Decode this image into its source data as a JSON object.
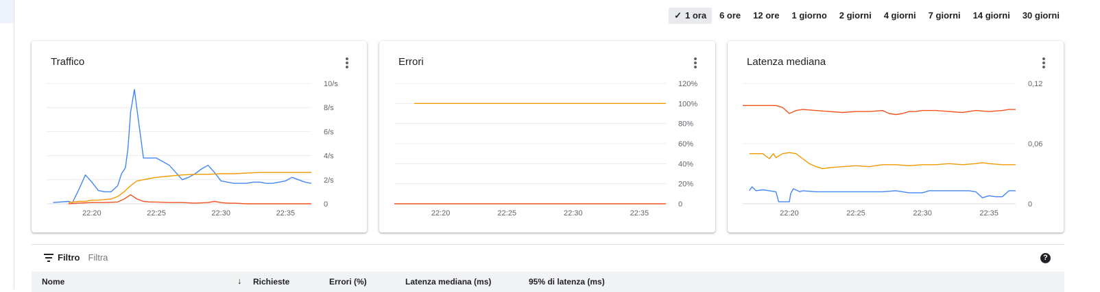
{
  "time_range": {
    "options": [
      "1 ora",
      "6 ore",
      "12 ore",
      "1 giorno",
      "2 giorni",
      "4 giorni",
      "7 giorni",
      "14 giorni",
      "30 giorni"
    ],
    "selected": "1 ora"
  },
  "filter": {
    "label": "Filtro",
    "placeholder": "Filtra"
  },
  "table": {
    "columns": [
      "Nome",
      "Richieste",
      "Errori (%)",
      "Latenza mediana (ms)",
      "95% di latenza (ms)"
    ],
    "sorted_column": "Richieste"
  },
  "colors": {
    "blue": "#4285f4",
    "orange": "#f29900",
    "red": "#f4511e"
  },
  "chart_data": [
    {
      "type": "line",
      "title": "Traffico",
      "x_ticks": [
        "22:20",
        "22:25",
        "22:30",
        "22:35"
      ],
      "y_ticks": [
        "0",
        "2/s",
        "4/s",
        "6/s",
        "8/s",
        "10/s"
      ],
      "ylim": [
        0,
        10
      ],
      "grid": true,
      "series": [
        {
          "color": "#4285f4",
          "x": [
            17,
            18.2,
            18.5,
            19,
            19.5,
            20,
            20.5,
            21,
            21.5,
            22,
            22.3,
            22.6,
            22.8,
            23,
            23.3,
            23.6,
            24,
            24.5,
            25,
            25.5,
            26,
            26.5,
            27,
            27.5,
            28,
            28.5,
            29,
            29.5,
            30,
            30.5,
            31,
            31.5,
            32,
            32.5,
            33,
            33.5,
            34,
            34.5,
            35,
            35.5,
            36,
            36.5,
            37
          ],
          "y": [
            0.1,
            0.2,
            0.1,
            1.2,
            2.4,
            1.8,
            1.1,
            1.0,
            1.0,
            1.5,
            2.5,
            3.0,
            4.6,
            7.6,
            9.5,
            7.0,
            3.8,
            3.8,
            3.8,
            3.5,
            3.2,
            2.6,
            2.0,
            2.2,
            2.5,
            2.9,
            3.2,
            2.6,
            1.9,
            1.8,
            1.7,
            1.7,
            1.7,
            1.8,
            1.8,
            1.7,
            1.7,
            1.8,
            1.9,
            2.2,
            2.0,
            1.8,
            1.7
          ]
        },
        {
          "color": "#f29900",
          "x": [
            18.2,
            19,
            19.5,
            20,
            20.5,
            21,
            21.5,
            22,
            22.5,
            23,
            23.5,
            24,
            24.5,
            25,
            26,
            27,
            28,
            29,
            30,
            31,
            32,
            33,
            34,
            35,
            36,
            37
          ],
          "y": [
            0.1,
            0.2,
            0.2,
            0.3,
            0.3,
            0.35,
            0.4,
            0.6,
            1.0,
            1.5,
            1.9,
            2.0,
            2.1,
            2.2,
            2.3,
            2.4,
            2.45,
            2.45,
            2.5,
            2.5,
            2.55,
            2.6,
            2.6,
            2.6,
            2.6,
            2.6
          ]
        },
        {
          "color": "#f4511e",
          "x": [
            18.2,
            19,
            20,
            21,
            22,
            22.5,
            23,
            23.5,
            24,
            24.5,
            25,
            26,
            27,
            28,
            29,
            29.5,
            30,
            30.5,
            31,
            32,
            33,
            34,
            35,
            36,
            37
          ],
          "y": [
            0,
            0.05,
            0.1,
            0.1,
            0.15,
            0.4,
            0.75,
            0.4,
            0.2,
            0.15,
            0.15,
            0.1,
            0.1,
            0.05,
            0.1,
            0.2,
            0.1,
            0.05,
            0.05,
            0,
            0,
            0,
            0,
            0,
            0
          ]
        }
      ]
    },
    {
      "type": "line",
      "title": "Errori",
      "x_ticks": [
        "22:20",
        "22:25",
        "22:30",
        "22:35"
      ],
      "y_ticks": [
        "0",
        "20%",
        "40%",
        "60%",
        "80%",
        "100%",
        "120%"
      ],
      "ylim": [
        0,
        120
      ],
      "grid": true,
      "series": [
        {
          "color": "#f29900",
          "x": [
            18,
            37
          ],
          "y": [
            100,
            100
          ]
        },
        {
          "color": "#f4511e",
          "x": [
            16.5,
            37
          ],
          "y": [
            0,
            0
          ]
        }
      ]
    },
    {
      "type": "line",
      "title": "Latenza mediana",
      "x_ticks": [
        "22:20",
        "22:25",
        "22:30",
        "22:35"
      ],
      "y_ticks": [
        "0",
        "0,06",
        "0,12"
      ],
      "ylim": [
        0,
        0.12
      ],
      "grid": true,
      "series": [
        {
          "color": "#f4511e",
          "x": [
            16.5,
            19,
            19.5,
            20,
            20.5,
            21,
            22,
            23,
            24,
            25,
            26,
            27,
            27.5,
            28,
            28.5,
            29,
            29.5,
            30,
            31,
            32,
            33,
            34,
            35,
            36,
            36.5,
            37
          ],
          "y": [
            0.098,
            0.098,
            0.096,
            0.09,
            0.093,
            0.094,
            0.093,
            0.092,
            0.091,
            0.092,
            0.092,
            0.093,
            0.09,
            0.089,
            0.09,
            0.092,
            0.092,
            0.093,
            0.093,
            0.092,
            0.091,
            0.093,
            0.092,
            0.093,
            0.094,
            0.094
          ]
        },
        {
          "color": "#f29900",
          "x": [
            17,
            18,
            18.5,
            18.8,
            19,
            19.5,
            20,
            20.5,
            21,
            21.5,
            22,
            22.5,
            23,
            24,
            25,
            26,
            27,
            28,
            29,
            30,
            31,
            32,
            33,
            34,
            34.5,
            35,
            36,
            37
          ],
          "y": [
            0.05,
            0.05,
            0.045,
            0.05,
            0.046,
            0.05,
            0.051,
            0.05,
            0.045,
            0.04,
            0.037,
            0.035,
            0.036,
            0.037,
            0.038,
            0.037,
            0.039,
            0.039,
            0.038,
            0.039,
            0.039,
            0.04,
            0.039,
            0.04,
            0.041,
            0.04,
            0.039,
            0.039
          ]
        },
        {
          "color": "#4285f4",
          "x": [
            17,
            17.2,
            17.5,
            18,
            18.5,
            19,
            19.2,
            19.5,
            20,
            20.1,
            20.3,
            20.8,
            21,
            22,
            23,
            24,
            25,
            26,
            27,
            28,
            29,
            30,
            30.5,
            31,
            32,
            33,
            33.5,
            34,
            34.5,
            35,
            35.5,
            36,
            36.5,
            37
          ],
          "y": [
            0.013,
            0.017,
            0.013,
            0.014,
            0.013,
            0.012,
            0.002,
            0.002,
            0.002,
            0.01,
            0.015,
            0.012,
            0.013,
            0.012,
            0.012,
            0.012,
            0.012,
            0.012,
            0.012,
            0.013,
            0.011,
            0.011,
            0.013,
            0.013,
            0.013,
            0.013,
            0.013,
            0.012,
            0.006,
            0.008,
            0.007,
            0.007,
            0.013,
            0.013
          ]
        }
      ]
    }
  ]
}
